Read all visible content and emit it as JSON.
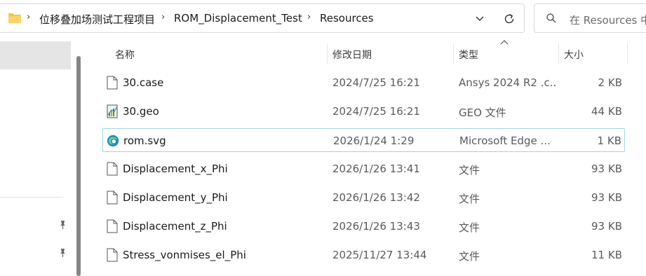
{
  "address_bar": {
    "crumbs": [
      "位移叠加场测试工程项目",
      "ROM_Displacement_Test",
      "Resources"
    ],
    "separator": "›"
  },
  "search": {
    "placeholder": "在 Resources 中"
  },
  "columns": {
    "name": "名称",
    "modified": "修改日期",
    "type": "类型",
    "size": "大小"
  },
  "files": [
    {
      "name": "30.case",
      "modified": "2024/7/25 16:21",
      "type": "Ansys 2024 R2 .c...",
      "size": "2 KB",
      "icon": "document-icon"
    },
    {
      "name": "30.geo",
      "modified": "2024/7/25 16:21",
      "type": "GEO 文件",
      "size": "44 KB",
      "icon": "geo-file-icon"
    },
    {
      "name": "rom.svg",
      "modified": "2026/1/24 1:29",
      "type": "Microsoft Edge ...",
      "size": "1 KB",
      "icon": "edge-icon"
    },
    {
      "name": "Displacement_x_Phi",
      "modified": "2026/1/26 13:41",
      "type": "文件",
      "size": "93 KB",
      "icon": "document-icon"
    },
    {
      "name": "Displacement_y_Phi",
      "modified": "2026/1/26 13:42",
      "type": "文件",
      "size": "93 KB",
      "icon": "document-icon"
    },
    {
      "name": "Displacement_z_Phi",
      "modified": "2026/1/26 13:43",
      "type": "文件",
      "size": "93 KB",
      "icon": "document-icon"
    },
    {
      "name": "Stress_vonmises_el_Phi",
      "modified": "2025/11/27 13:44",
      "type": "文件",
      "size": "11 KB",
      "icon": "document-icon"
    }
  ],
  "colors": {
    "focus_border": "#9ed6e6",
    "nav_selected": "#e5e5e5",
    "folder": "#f6c445"
  }
}
